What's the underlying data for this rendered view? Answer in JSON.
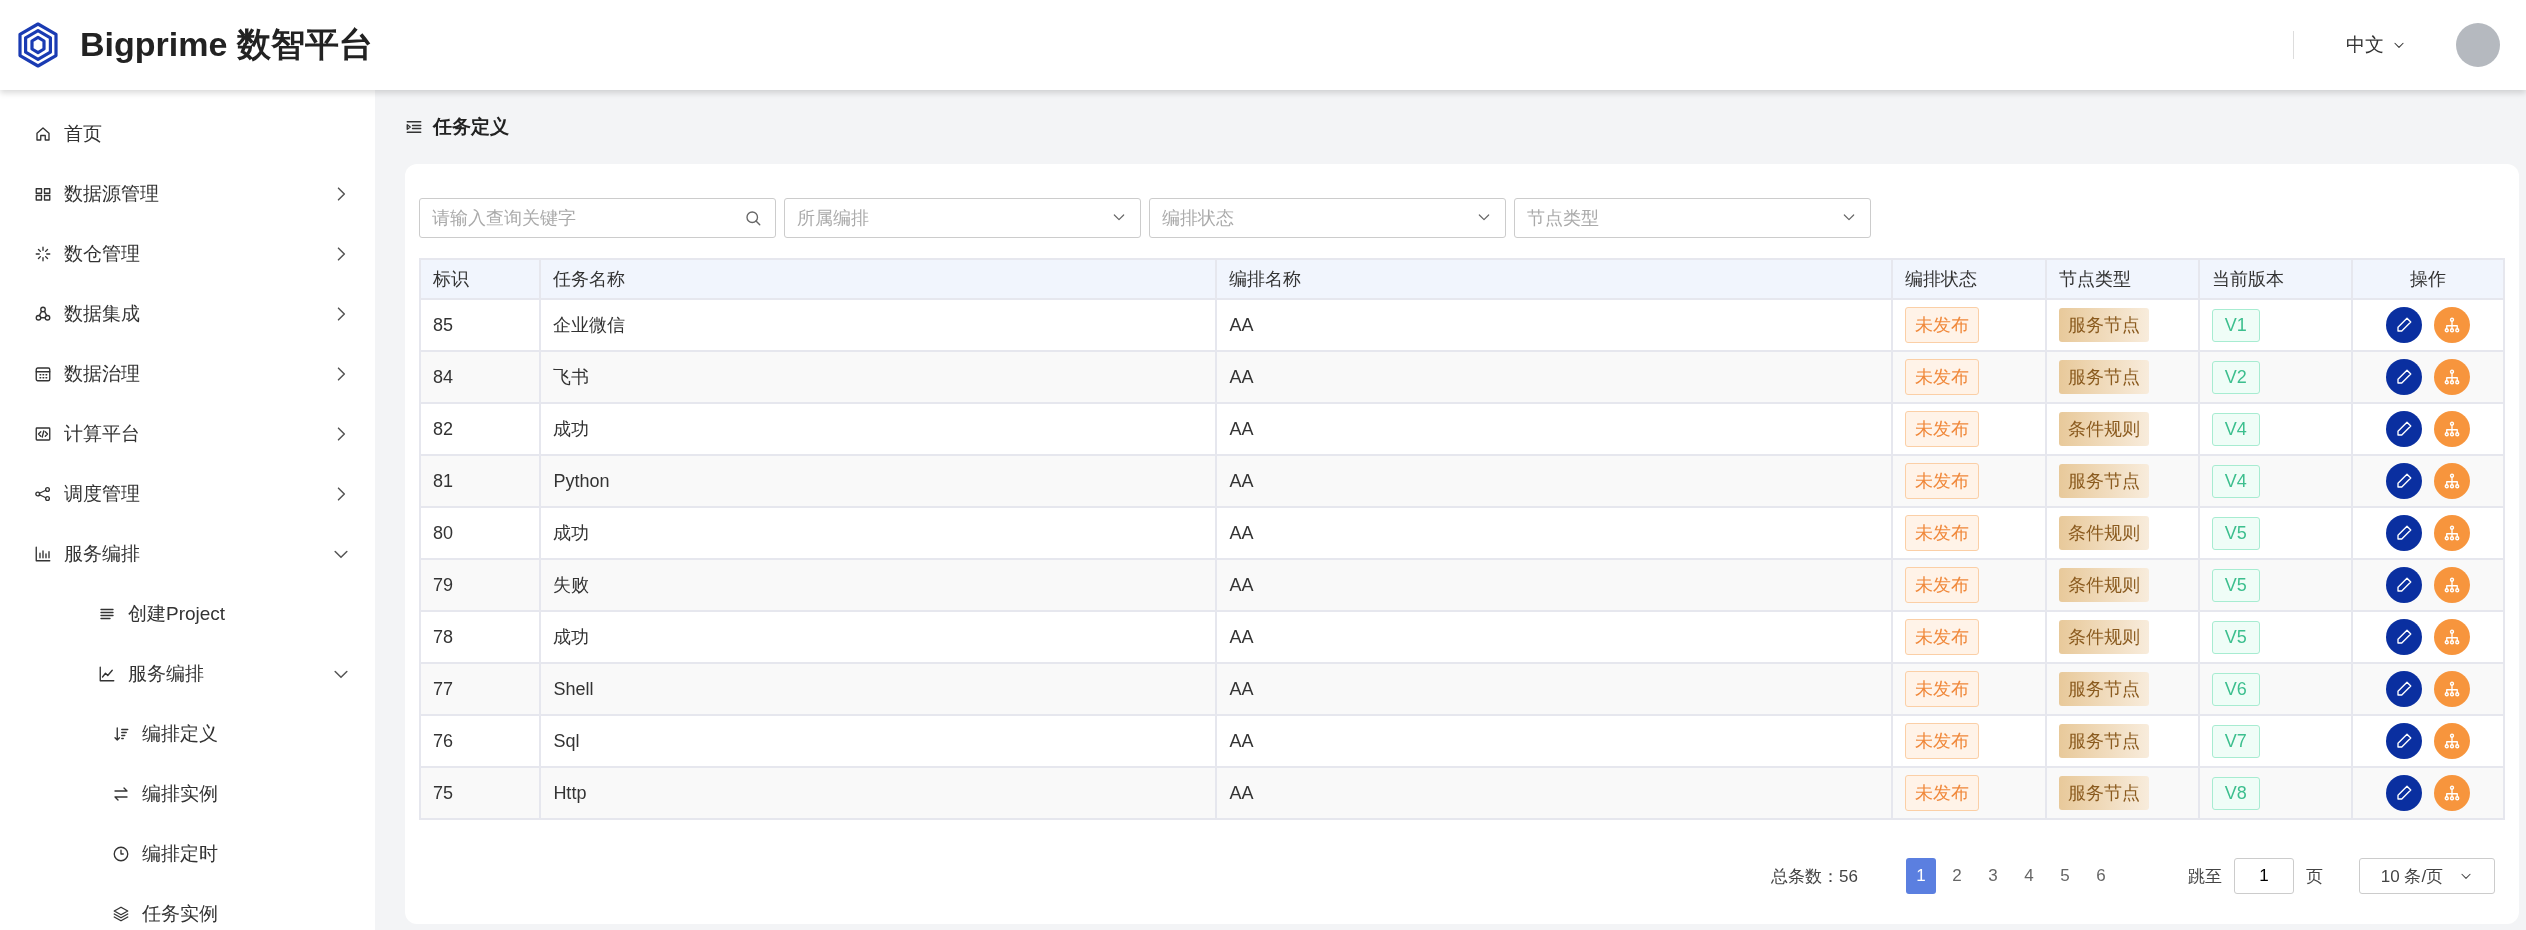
{
  "header": {
    "brand": "Bigprime 数智平台",
    "language": "中文"
  },
  "sidebar": {
    "items": [
      {
        "label": "首页"
      },
      {
        "label": "数据源管理",
        "expanded": false
      },
      {
        "label": "数仓管理",
        "expanded": false
      },
      {
        "label": "数据集成",
        "expanded": false
      },
      {
        "label": "数据治理",
        "expanded": false
      },
      {
        "label": "计算平台",
        "expanded": false
      },
      {
        "label": "调度管理",
        "expanded": false
      },
      {
        "label": "服务编排",
        "expanded": true,
        "children": [
          {
            "label": "创建Project"
          },
          {
            "label": "服务编排",
            "expanded": true,
            "children": [
              {
                "label": "编排定义"
              },
              {
                "label": "编排实例"
              },
              {
                "label": "编排定时"
              },
              {
                "label": "任务实例"
              }
            ]
          }
        ]
      }
    ]
  },
  "breadcrumb": "任务定义",
  "filters": [
    {
      "kind": "search",
      "placeholder": "请输入查询关键字"
    },
    {
      "kind": "select",
      "placeholder": "所属编排"
    },
    {
      "kind": "select",
      "placeholder": "编排状态"
    },
    {
      "kind": "select",
      "placeholder": "节点类型"
    }
  ],
  "table": {
    "columns": [
      "标识",
      "任务名称",
      "编排名称",
      "编排状态",
      "节点类型",
      "当前版本",
      "操作"
    ],
    "rows": [
      {
        "id": "85",
        "name": "企业微信",
        "flow": "AA",
        "status": "未发布",
        "node_type": "服务节点",
        "version": "V1"
      },
      {
        "id": "84",
        "name": "飞书",
        "flow": "AA",
        "status": "未发布",
        "node_type": "服务节点",
        "version": "V2"
      },
      {
        "id": "82",
        "name": "成功",
        "flow": "AA",
        "status": "未发布",
        "node_type": "条件规则",
        "version": "V4"
      },
      {
        "id": "81",
        "name": "Python",
        "flow": "AA",
        "status": "未发布",
        "node_type": "服务节点",
        "version": "V4"
      },
      {
        "id": "80",
        "name": "成功",
        "flow": "AA",
        "status": "未发布",
        "node_type": "条件规则",
        "version": "V5"
      },
      {
        "id": "79",
        "name": "失败",
        "flow": "AA",
        "status": "未发布",
        "node_type": "条件规则",
        "version": "V5"
      },
      {
        "id": "78",
        "name": "成功",
        "flow": "AA",
        "status": "未发布",
        "node_type": "条件规则",
        "version": "V5"
      },
      {
        "id": "77",
        "name": "Shell",
        "flow": "AA",
        "status": "未发布",
        "node_type": "服务节点",
        "version": "V6"
      },
      {
        "id": "76",
        "name": "Sql",
        "flow": "AA",
        "status": "未发布",
        "node_type": "服务节点",
        "version": "V7"
      },
      {
        "id": "75",
        "name": "Http",
        "flow": "AA",
        "status": "未发布",
        "node_type": "服务节点",
        "version": "V8"
      }
    ]
  },
  "pagination": {
    "total": "总条数：56",
    "pages": [
      {
        "label": "1",
        "selected": true
      },
      {
        "label": "2",
        "selected": false
      },
      {
        "label": "3",
        "selected": false
      },
      {
        "label": "4",
        "selected": false
      },
      {
        "label": "5",
        "selected": false
      },
      {
        "label": "6",
        "selected": false
      }
    ],
    "jump_label": "跳至",
    "jump_value": "1",
    "page_unit": "页",
    "page_size": "10 条/页"
  }
}
